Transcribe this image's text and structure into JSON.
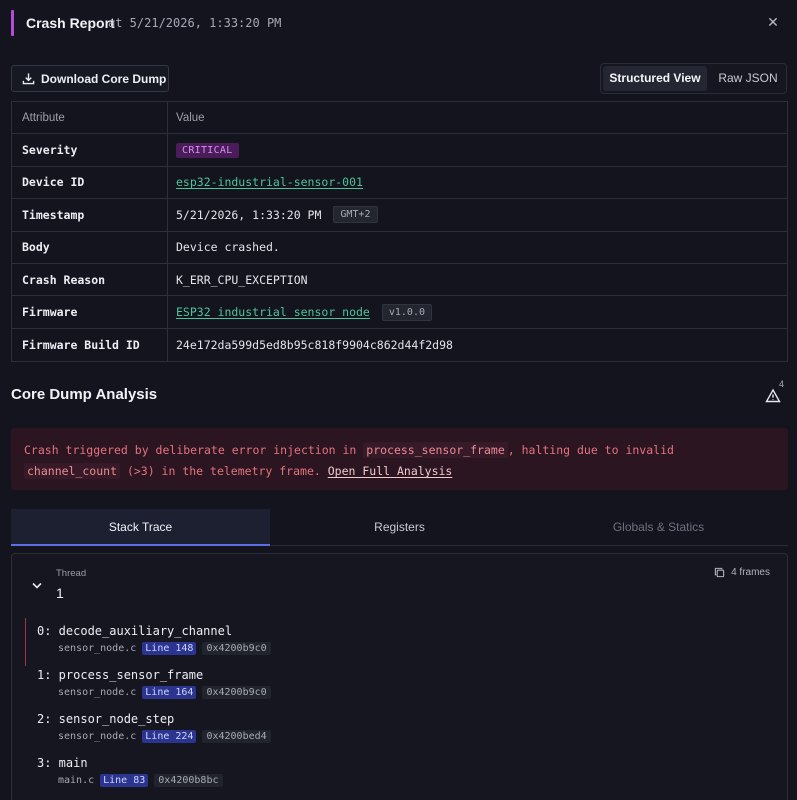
{
  "header": {
    "title": "Crash Report",
    "timestamp": "at 5/21/2026, 1:33:20 PM",
    "close_icon": "close-icon"
  },
  "toolbar": {
    "download_label": "Download Core Dump",
    "view_structured": "Structured View",
    "view_raw": "Raw JSON"
  },
  "table": {
    "head_attribute": "Attribute",
    "head_value": "Value",
    "rows": [
      {
        "key": "Severity",
        "value": "CRITICAL"
      },
      {
        "key": "Device ID",
        "value": "esp32-industrial-sensor-001"
      },
      {
        "key": "Timestamp",
        "value": "5/21/2026, 1:33:20 PM",
        "chip": "GMT+2"
      },
      {
        "key": "Body",
        "value": "Device crashed."
      },
      {
        "key": "Crash Reason",
        "value": "K_ERR_CPU_EXCEPTION"
      },
      {
        "key": "Firmware",
        "value": "ESP32 industrial sensor node",
        "chip": "v1.0.0"
      },
      {
        "key": "Firmware Build ID",
        "value": "24e172da599d5ed8b95c818f9904c862d44f2d98"
      }
    ]
  },
  "analysis": {
    "title": "Core Dump Analysis",
    "warning_count": "4",
    "alert": {
      "p1": "Crash triggered by deliberate error injection in ",
      "code1": "process_sensor_frame",
      "p2": ", halting due to invalid ",
      "code2": "channel_count",
      "p3": " (>3) in the telemetry frame. ",
      "link": "Open Full Analysis"
    }
  },
  "tabs": [
    "Stack Trace",
    "Registers",
    "Globals & Statics"
  ],
  "stack": {
    "thread_label": "Thread",
    "thread_number": "1",
    "frames_count": "4 frames",
    "frames": [
      {
        "fn": "0: decode_auxiliary_channel",
        "file": "sensor_node.c",
        "line": "Line 148",
        "addr": "0x4200b9c0"
      },
      {
        "fn": "1: process_sensor_frame",
        "file": "sensor_node.c",
        "line": "Line 164",
        "addr": "0x4200b9c0"
      },
      {
        "fn": "2: sensor_node_step",
        "file": "sensor_node.c",
        "line": "Line 224",
        "addr": "0x4200bed4"
      },
      {
        "fn": "3: main",
        "file": "main.c",
        "line": "Line 83",
        "addr": "0x4200b8bc"
      }
    ]
  },
  "colors": {
    "background": "#13141d",
    "accent": "#b44cd6",
    "link": "#4cc39b",
    "critical": "#d78ff0",
    "alert_text": "#e5737f",
    "tab_active": "#5b6ee8"
  }
}
